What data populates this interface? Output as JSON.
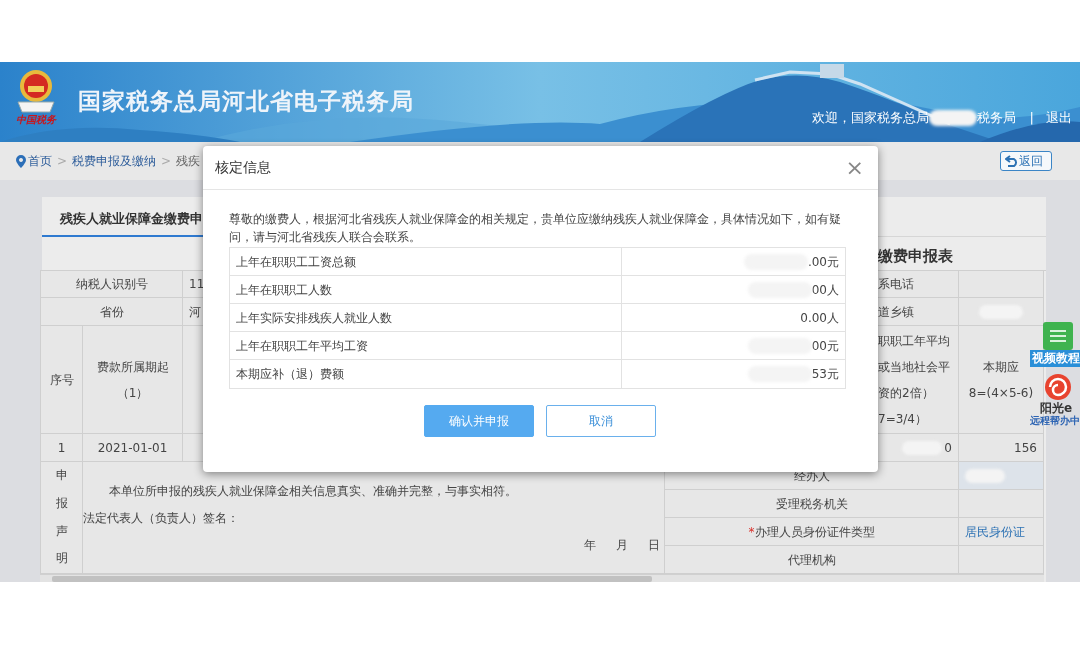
{
  "header": {
    "logo_text": "中国税务",
    "title": "国家税务总局河北省电子税务局",
    "welcome_prefix": "欢迎，国家税务总局",
    "welcome_redacted": true,
    "welcome_suffix": "税务局",
    "separator": "|",
    "logout": "退出"
  },
  "breadcrumb": {
    "items": [
      {
        "kind": "home",
        "label": "首页"
      },
      {
        "kind": "separator",
        "label": ">"
      },
      {
        "kind": "link",
        "label": "税费申报及缴纳"
      },
      {
        "kind": "separator",
        "label": ">"
      },
      {
        "kind": "current",
        "label": "残疾"
      }
    ],
    "back_button": "返回"
  },
  "form": {
    "tab": {
      "label": "残疾人就业保障金缴费申",
      "selected": true
    },
    "title": "缴费申报表",
    "info_rows": [
      {
        "label": "纳税人识别号",
        "value": "11",
        "right_label": "系电话"
      },
      {
        "label": "省份",
        "value": "河",
        "right_label": "道乡镇",
        "right_redacted": true
      }
    ],
    "header_row": {
      "index": "序号",
      "period_start": [
        "费款所属期起",
        "（1）"
      ],
      "column_5": [
        "职职工年平均",
        "或当地社会平",
        "资的2倍）",
        "7=3/4）"
      ],
      "column_6": [
        "本期应",
        "8=(4×5-6)"
      ]
    },
    "data_row": {
      "index": "1",
      "period_start": "2021-01-01",
      "column_5": "0",
      "column_5_redacted": true,
      "column_6": "156"
    },
    "declaration": {
      "heading": "申报声明",
      "statement": "本单位所申报的残疾人就业保障金相关信息真实、准确并完整，与事实相符。",
      "signature": "法定代表人（负责人）签名：",
      "date": [
        "年",
        "月",
        "日"
      ]
    },
    "right_fields": [
      {
        "label": "经办人",
        "redacted": true
      },
      {
        "label": "受理税务机关"
      },
      {
        "required_mark": "*",
        "label": "办理人员身份证件类型",
        "value": "居民身份证"
      },
      {
        "label": "代理机构"
      }
    ]
  },
  "dialog": {
    "title": "核定信息",
    "close": "×",
    "message": "尊敬的缴费人，根据河北省残疾人就业保障金的相关规定，贵单位应缴纳残疾人就业保障金，具体情况如下，如有疑问，请与河北省残疾人联合会联系。",
    "rows": [
      {
        "label": "上年在职职工工资总额",
        "value": ".00元",
        "redacted": true
      },
      {
        "label": "上年在职职工人数",
        "value": "00人",
        "redacted": true
      },
      {
        "label": "上年实际安排残疾人就业人数",
        "value": "0.00人"
      },
      {
        "label": "上年在职职工年平均工资",
        "value": "00元",
        "redacted": true
      },
      {
        "label": "本期应补（退）费额",
        "value": "53元",
        "redacted": true
      }
    ],
    "buttons": [
      {
        "kind": "primary",
        "label": "确认并申报"
      },
      {
        "kind": "secondary",
        "label": "取消"
      }
    ]
  },
  "widget": {
    "video_label": "视频教程",
    "brand": "阳光e",
    "caption": "远程帮办中"
  }
}
